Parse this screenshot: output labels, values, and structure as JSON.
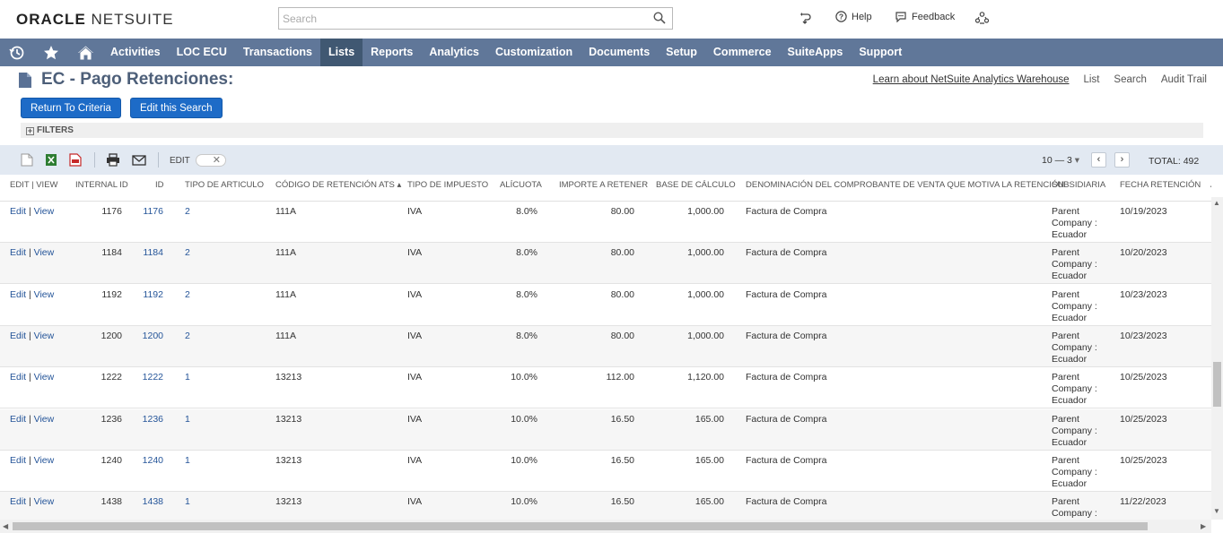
{
  "header": {
    "logo_bold": "ORACLE",
    "logo_light": "NETSUITE",
    "search_placeholder": "Search",
    "help": "Help",
    "feedback": "Feedback"
  },
  "nav": {
    "items": [
      "Activities",
      "LOC ECU",
      "Transactions",
      "Lists",
      "Reports",
      "Analytics",
      "Customization",
      "Documents",
      "Setup",
      "Commerce",
      "SuiteApps",
      "Support"
    ],
    "active": "Lists"
  },
  "page": {
    "title": "EC - Pago Retenciones:",
    "links": {
      "analytics": "Learn about NetSuite Analytics Warehouse",
      "list": "List",
      "search": "Search",
      "audit": "Audit Trail"
    },
    "buttons": {
      "return": "Return To Criteria",
      "edit_search": "Edit this Search"
    },
    "filters": "FILTERS"
  },
  "toolbar": {
    "edit_label": "EDIT",
    "pager": "10 — 3",
    "total": "TOTAL: 492"
  },
  "table": {
    "headers": [
      "EDIT | VIEW",
      "INTERNAL ID",
      "ID",
      "TIPO DE ARTICULO",
      "CÓDIGO DE RETENCIÓN ATS ▴",
      "TIPO DE IMPUESTO",
      "ALÍCUOTA",
      "IMPORTE A RETENER",
      "BASE DE CÁLCULO",
      "DENOMINACIÓN DEL COMPROBANTE DE VENTA QUE MOTIVA LA RETENCIÓN",
      "SUBSIDIARIA",
      "FECHA RETENCIÓN",
      "AN"
    ],
    "edit_text": "Edit",
    "view_text": "View",
    "rows": [
      {
        "internal_id": "1176",
        "id": "1176",
        "tipo": "2",
        "codigo": "111A",
        "impuesto": "IVA",
        "alicuota": "8.0%",
        "importe": "80.00",
        "base": "1,000.00",
        "denominacion": "Factura de Compra",
        "subsidiaria": "Parent Company : Ecuador",
        "fecha": "10/19/2023"
      },
      {
        "internal_id": "1184",
        "id": "1184",
        "tipo": "2",
        "codigo": "111A",
        "impuesto": "IVA",
        "alicuota": "8.0%",
        "importe": "80.00",
        "base": "1,000.00",
        "denominacion": "Factura de Compra",
        "subsidiaria": "Parent Company : Ecuador",
        "fecha": "10/20/2023"
      },
      {
        "internal_id": "1192",
        "id": "1192",
        "tipo": "2",
        "codigo": "111A",
        "impuesto": "IVA",
        "alicuota": "8.0%",
        "importe": "80.00",
        "base": "1,000.00",
        "denominacion": "Factura de Compra",
        "subsidiaria": "Parent Company : Ecuador",
        "fecha": "10/23/2023"
      },
      {
        "internal_id": "1200",
        "id": "1200",
        "tipo": "2",
        "codigo": "111A",
        "impuesto": "IVA",
        "alicuota": "8.0%",
        "importe": "80.00",
        "base": "1,000.00",
        "denominacion": "Factura de Compra",
        "subsidiaria": "Parent Company : Ecuador",
        "fecha": "10/23/2023"
      },
      {
        "internal_id": "1222",
        "id": "1222",
        "tipo": "1",
        "codigo": "13213",
        "impuesto": "IVA",
        "alicuota": "10.0%",
        "importe": "112.00",
        "base": "1,120.00",
        "denominacion": "Factura de Compra",
        "subsidiaria": "Parent Company : Ecuador",
        "fecha": "10/25/2023"
      },
      {
        "internal_id": "1236",
        "id": "1236",
        "tipo": "1",
        "codigo": "13213",
        "impuesto": "IVA",
        "alicuota": "10.0%",
        "importe": "16.50",
        "base": "165.00",
        "denominacion": "Factura de Compra",
        "subsidiaria": "Parent Company : Ecuador",
        "fecha": "10/25/2023"
      },
      {
        "internal_id": "1240",
        "id": "1240",
        "tipo": "1",
        "codigo": "13213",
        "impuesto": "IVA",
        "alicuota": "10.0%",
        "importe": "16.50",
        "base": "165.00",
        "denominacion": "Factura de Compra",
        "subsidiaria": "Parent Company : Ecuador",
        "fecha": "10/25/2023"
      },
      {
        "internal_id": "1438",
        "id": "1438",
        "tipo": "1",
        "codigo": "13213",
        "impuesto": "IVA",
        "alicuota": "10.0%",
        "importe": "16.50",
        "base": "165.00",
        "denominacion": "Factura de Compra",
        "subsidiaria": "Parent Company : Ecuador",
        "fecha": "11/22/2023"
      }
    ]
  },
  "colors": {
    "nav_bg": "#607799",
    "nav_active": "#405872",
    "button": "#1d6bc7",
    "link": "#255599"
  }
}
